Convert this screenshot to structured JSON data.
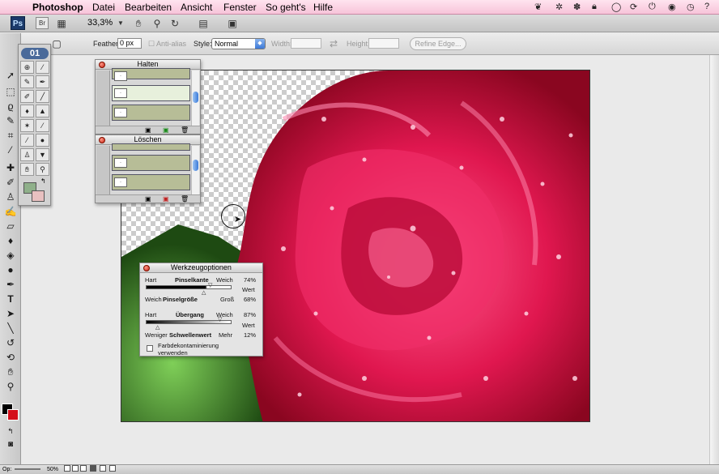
{
  "menubar": {
    "app_name": "Photoshop",
    "items": [
      "Datei",
      "Bearbeiten",
      "Ansicht",
      "Fenster",
      "So geht's",
      "Hilfe"
    ]
  },
  "appbar": {
    "ps_logo": "Ps",
    "br_logo": "Br",
    "zoom": "33,3%"
  },
  "options": {
    "feather_label": "Feather:",
    "feather_value": "0 px",
    "antialias_label": "Anti-alias",
    "style_label": "Style:",
    "style_value": "Normal",
    "width_label": "Width:",
    "height_label": "Height:",
    "refine_label": "Refine Edge..."
  },
  "toolpanel": {
    "logo": "01"
  },
  "history_palette": {
    "title": "Halten"
  },
  "delete_palette": {
    "title": "Löschen"
  },
  "werkzeug": {
    "title": "Werkzeugoptionen",
    "hart1": "Hart",
    "pinselkante": "Pinselkante",
    "weich1": "Weich",
    "val1": "74%",
    "wert1": "Wert",
    "weich2": "Weich",
    "pinselgroesse": "Pinselgröße",
    "gross": "Groß",
    "val2": "68%",
    "hart3": "Hart",
    "uebergang": "Übergang",
    "weich3": "Weich",
    "val3": "87%",
    "wert3": "Wert",
    "weniger": "Weniger",
    "schwellenwert": "Schwellenwert",
    "mehr": "Mehr",
    "val4": "12%",
    "farb1": "Farbdekontaminierung",
    "farb2": "verwenden"
  },
  "status": {
    "op": "Op:",
    "zoom": "50%"
  },
  "colors": {
    "foreground": "#000000",
    "background": "#d40f1a",
    "rose": "#e0174f"
  }
}
